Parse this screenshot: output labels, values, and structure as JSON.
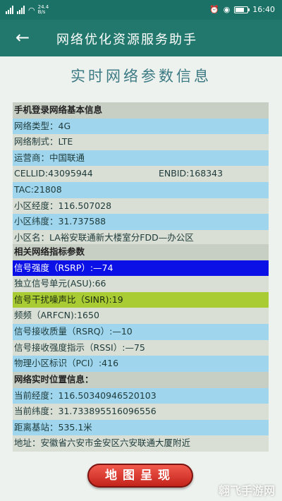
{
  "status_bar": {
    "net_speed": "24.4 B/s",
    "time": "16:40"
  },
  "app_bar": {
    "back_icon": "←",
    "title": "网络优化资源服务助手"
  },
  "page_title": "实时网络参数信息",
  "basic_section": {
    "header": "手机登录网络基本信息",
    "network_type": "网络类型：4G",
    "network_mode": "网络制式：LTE",
    "operator": "运营商：中国联通",
    "cellid": "CELLID:43095944",
    "enbid": "ENBID:168343",
    "tac": "TAC:21808",
    "longitude": "小区经度：116.507028",
    "latitude": "小区纬度：31.737588",
    "cell_name": "小区名：LA裕安联通新大楼室分FDD—办公区"
  },
  "metrics_section": {
    "header": "相关网络指标参数",
    "rsrp": "信号强度（RSRP）:—74",
    "asu": "独立信号单元(ASU):66",
    "sinr": "信号干扰噪声比（SINR):19",
    "arfcn": "频频（ARFCN):1650",
    "rsrq": "信号接收质量（RSRQ）:—10",
    "rssi": "信号接收强度指示（RSSI）:—75",
    "pci": "物理小区标识（PCI）:416"
  },
  "location_section": {
    "header": "网络实时位置信息：",
    "current_longitude": "当前经度：116.50340946520103",
    "current_latitude": "当前纬度：31.733895516096556",
    "distance": "距离基站：535.1米",
    "address": "地址：安徽省六安市金安区六安联通大厦附近"
  },
  "map_button_label": "地图呈现",
  "watermark": "翱飞手游网",
  "colors": {
    "app_bar": "#23786d",
    "rsrp_highlight": "#0a10e6",
    "sinr_highlight": "#a9cc34",
    "button": "#d8352a"
  }
}
